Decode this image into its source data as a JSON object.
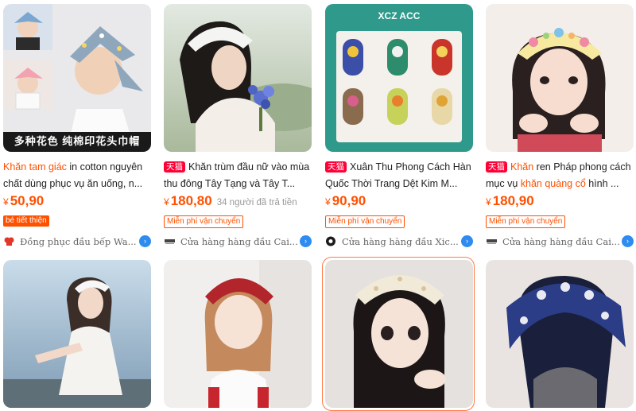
{
  "products": [
    {
      "title_highlight": "Khăn tam giác",
      "title_rest": " in cotton nguyên chất dùng phục vụ ăn uống, n...",
      "currency": "¥",
      "price": "50,90",
      "tag": "bé tiết thiện",
      "shop": "Đồng phục đầu bếp Wa...",
      "image_caption": "多种花色 纯棉印花头巾帽"
    },
    {
      "badge": "天猫",
      "title_rest": "Khăn trùm đầu nữ vào mùa thu đông Tây Tạng và Tây T...",
      "currency": "¥",
      "price": "180,80",
      "sold": "34 người đã trả tiền",
      "tag": "Miễn phí vận chuyển",
      "shop": "Cửa hàng hàng đầu Cai..."
    },
    {
      "badge": "天猫",
      "title_rest": "Xuân Thu Phong Cách Hàn Quốc Thời Trang Dệt Kim M...",
      "currency": "¥",
      "price": "90,90",
      "tag": "Miễn phí vận chuyển",
      "shop": "Cửa hàng hàng đầu Xic...",
      "image_caption": "XCZ ACC"
    },
    {
      "badge": "天猫",
      "title_pre": "Khăn",
      "title_mid": " ren Pháp phong cách mục vụ ",
      "title_hl2": "khăn quàng cổ",
      "title_end": " hình ...",
      "currency": "¥",
      "price": "180,90",
      "tag": "Miễn phí vận chuyển",
      "shop": "Cửa hàng hàng đầu Cai..."
    }
  ],
  "colors": {
    "accent": "#ff5000",
    "tmall": "#ff0036",
    "shop_arrow": "#2e8cf0"
  }
}
